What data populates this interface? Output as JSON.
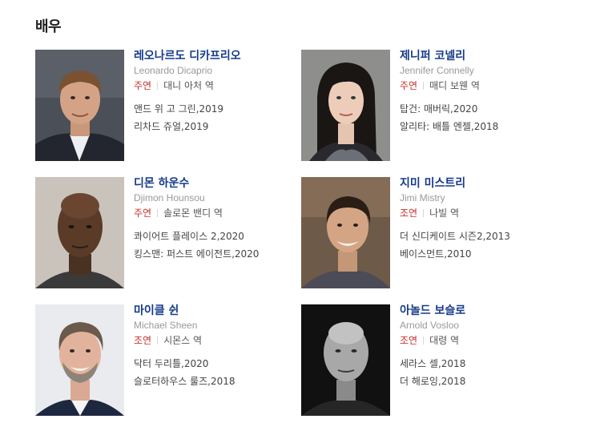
{
  "section": {
    "title": "배우"
  },
  "actors": [
    {
      "name_ko": "레오나르도 디카프리오",
      "name_en": "Leonardo Dicaprio",
      "role_type": "주연",
      "role": "대니 아처 역",
      "works": [
        "앤드 위 고 그린,2019",
        "리차드 쥬얼,2019"
      ],
      "photo": "leonardo-dicaprio-photo"
    },
    {
      "name_ko": "제니퍼 코넬리",
      "name_en": "Jennifer Connelly",
      "role_type": "주연",
      "role": "매디 보웬 역",
      "works": [
        "탑건: 매버릭,2020",
        "알리타: 배틀 엔젤,2018"
      ],
      "photo": "jennifer-connelly-photo"
    },
    {
      "name_ko": "디몬 하운수",
      "name_en": "Djimon Hounsou",
      "role_type": "주연",
      "role": "솔로몬 밴디 역",
      "works": [
        "콰이어트 플레이스 2,2020",
        "킹스맨: 퍼스트 에이전트,2020"
      ],
      "photo": "djimon-hounsou-photo"
    },
    {
      "name_ko": "지미 미스트리",
      "name_en": "Jimi Mistry",
      "role_type": "조연",
      "role": "나빌 역",
      "works": [
        "더 신디케이트 시즌2,2013",
        "베이스먼트,2010"
      ],
      "photo": "jimi-mistry-photo"
    },
    {
      "name_ko": "마이클 쉰",
      "name_en": "Michael Sheen",
      "role_type": "조연",
      "role": "시몬스 역",
      "works": [
        "닥터 두리틀,2020",
        "슬로터하우스 룰즈,2018"
      ],
      "photo": "michael-sheen-photo"
    },
    {
      "name_ko": "아놀드 보슬로",
      "name_en": "Arnold Vosloo",
      "role_type": "조연",
      "role": "대령 역",
      "works": [
        "세라스 셀,2018",
        "더 해로잉,2018"
      ],
      "photo": "arnold-vosloo-photo"
    }
  ],
  "colors": {
    "name": "#153a8a",
    "role_type": "#c8312b",
    "english_name": "#999999",
    "text": "#444444"
  }
}
